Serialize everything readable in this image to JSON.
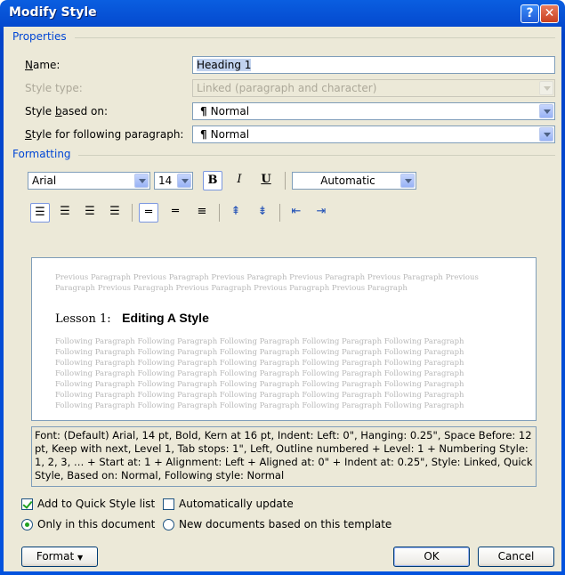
{
  "window": {
    "title": "Modify Style"
  },
  "properties": {
    "group_label": "Properties",
    "name_label": "Name:",
    "name_value": "Heading 1",
    "style_type_label": "Style type:",
    "style_type_value": "Linked (paragraph and character)",
    "based_on_label": "Style based on:",
    "based_on_value": "Normal",
    "following_label": "Style for following paragraph:",
    "following_value": "Normal"
  },
  "formatting": {
    "group_label": "Formatting",
    "font": "Arial",
    "size": "14",
    "bold": "B",
    "italic": "I",
    "underline": "U",
    "color": "Automatic"
  },
  "preview": {
    "previous_text": "Previous Paragraph Previous Paragraph Previous Paragraph Previous Paragraph Previous Paragraph Previous Paragraph Previous Paragraph Previous Paragraph Previous Paragraph Previous Paragraph",
    "heading_number": "Lesson 1:",
    "heading_text": "Editing A Style",
    "following_line": "Following Paragraph Following Paragraph Following Paragraph Following Paragraph Following Paragraph"
  },
  "description": "Font: (Default) Arial, 14 pt, Bold, Kern at 16 pt, Indent: Left:  0\", Hanging:  0.25\", Space Before:  12 pt, Keep with next, Level 1, Tab stops:  1\", Left, Outline numbered + Level: 1 + Numbering Style: 1, 2, 3, … + Start at: 1 + Alignment: Left + Aligned at:  0\" + Indent at:  0.25\", Style: Linked, Quick Style, Based on: Normal, Following style: Normal",
  "options": {
    "add_quick_style": "Add to Quick Style list",
    "auto_update": "Automatically update",
    "only_this_doc": "Only in this document",
    "new_docs": "New documents based on this template"
  },
  "buttons": {
    "format": "Format",
    "ok": "OK",
    "cancel": "Cancel"
  }
}
